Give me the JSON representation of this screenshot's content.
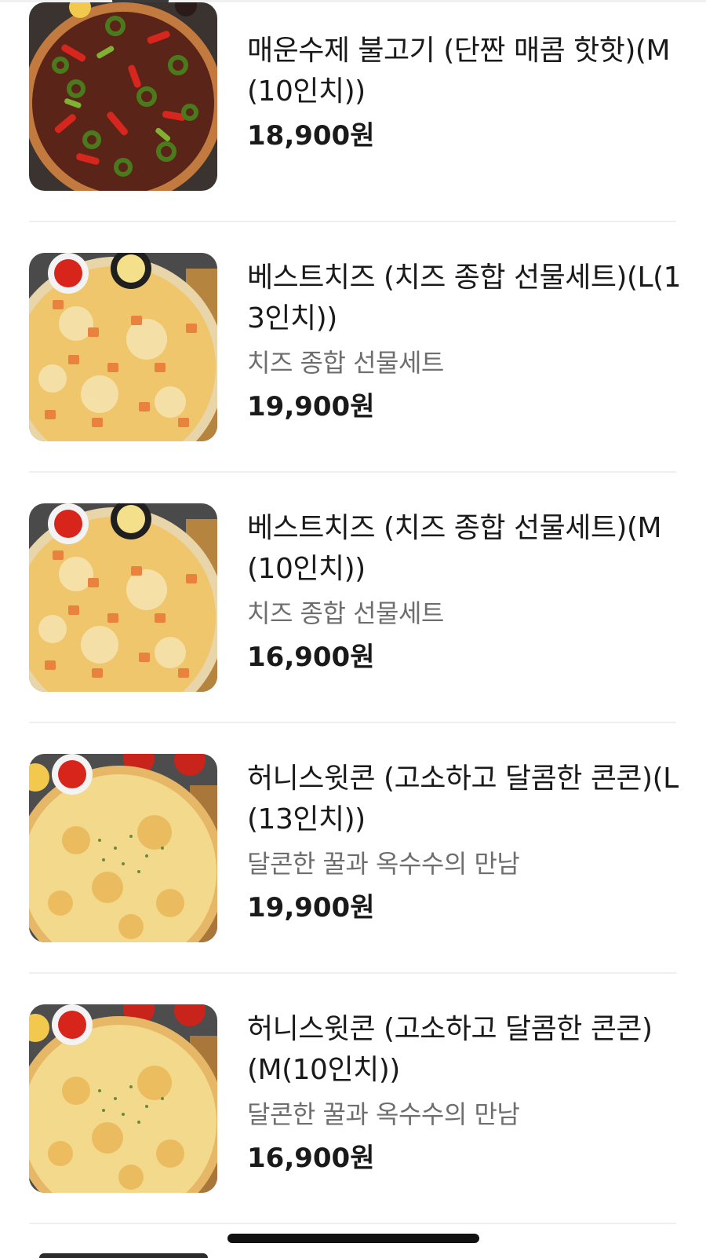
{
  "menu": {
    "items": [
      {
        "name": "매운수제 불고기 (단짠 매콤 핫핫)(M(10인치))",
        "description": "",
        "price": "18,900원",
        "image": "spicy-bulgogi-pizza-photo"
      },
      {
        "name": "베스트치즈 (치즈 종합 선물세트)(L(13인치))",
        "description": "치즈 종합 선물세트",
        "price": "19,900원",
        "image": "best-cheese-pizza-photo"
      },
      {
        "name": "베스트치즈 (치즈 종합 선물세트)(M(10인치))",
        "description": "치즈 종합 선물세트",
        "price": "16,900원",
        "image": "best-cheese-pizza-photo"
      },
      {
        "name": "허니스윗콘 (고소하고 달콤한 콘콘)(L(13인치))",
        "description": "달콘한 꿀과 옥수수의 만남",
        "price": "19,900원",
        "image": "honey-sweet-corn-pizza-photo"
      },
      {
        "name": "허니스윗콘 (고소하고 달콤한 콘콘)(M(10인치))",
        "description": "달콘한 꿀과 옥수수의 만남",
        "price": "16,900원",
        "image": "honey-sweet-corn-pizza-photo"
      }
    ]
  },
  "colors": {
    "text_primary": "#1a1a1a",
    "text_secondary": "#6e6e6e",
    "divider": "#efefef",
    "background": "#ffffff"
  }
}
